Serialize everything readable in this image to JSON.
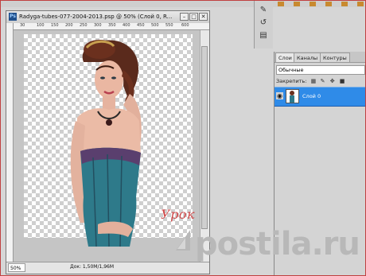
{
  "document": {
    "title": "Radyga-tubes-077-2004-2013.psp @ 50% (Слой 0, R...",
    "app_icon": "Ps",
    "window_buttons": [
      "–",
      "□",
      "✕"
    ],
    "ruler_ticks": [
      "30",
      "100",
      "150",
      "200",
      "250",
      "300",
      "350",
      "400",
      "450",
      "500",
      "550",
      "600"
    ],
    "zoom": "50%",
    "doc_info": "Док: 1,50M/1,96M",
    "watermark_text": "Урок от SAnna"
  },
  "layers_panel": {
    "tabs": [
      "Слои",
      "Каналы",
      "Контуры"
    ],
    "active_tab": 0,
    "blend_mode": "Обычные",
    "lock_label": "Закрепить:",
    "lock_icons": [
      "lock-transparency-icon",
      "lock-paint-icon",
      "lock-position-icon",
      "lock-all-icon"
    ],
    "layers": [
      {
        "name": "Слой 0",
        "visible": true,
        "selected": true
      }
    ]
  },
  "overlay": {
    "postila_text": "postila.ru"
  },
  "colors": {
    "accent_selected": "#2f8be8",
    "watermark_red": "#d04848",
    "postila_grey": "#b8b8b8"
  }
}
